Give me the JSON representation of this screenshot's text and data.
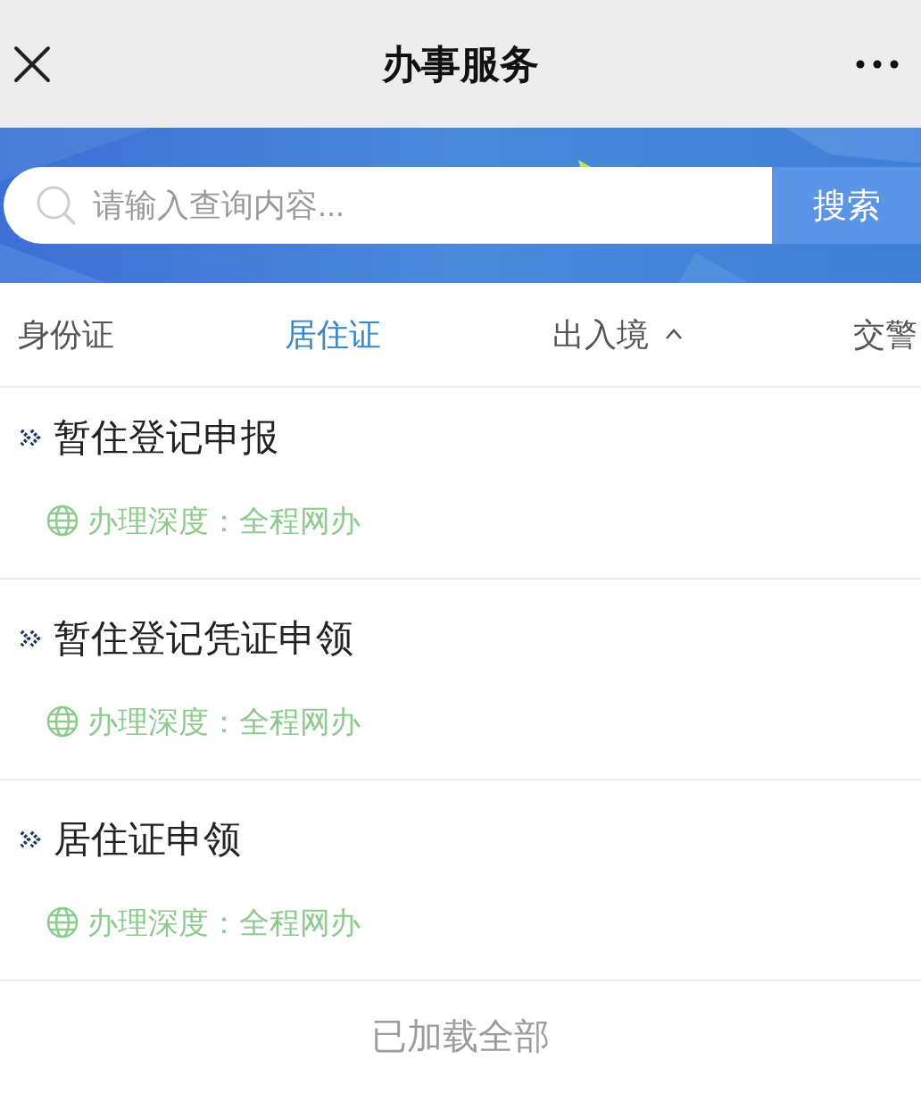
{
  "window": {
    "title": "办事服务"
  },
  "search": {
    "placeholder": "请输入查询内容...",
    "button": "搜索"
  },
  "tabs": [
    {
      "label": "身份证",
      "selected": false
    },
    {
      "label": "居住证",
      "selected": true
    },
    {
      "label": "出入境",
      "selected": false,
      "dropdown": true,
      "expanded": true
    },
    {
      "label": "交警",
      "selected": false
    }
  ],
  "services": [
    {
      "title": "暂住登记申报",
      "depth": "办理深度：全程网办"
    },
    {
      "title": "暂住登记凭证申领",
      "depth": "办理深度：全程网办"
    },
    {
      "title": "居住证申领",
      "depth": "办理深度：全程网办"
    }
  ],
  "footer": "已加载全部"
}
